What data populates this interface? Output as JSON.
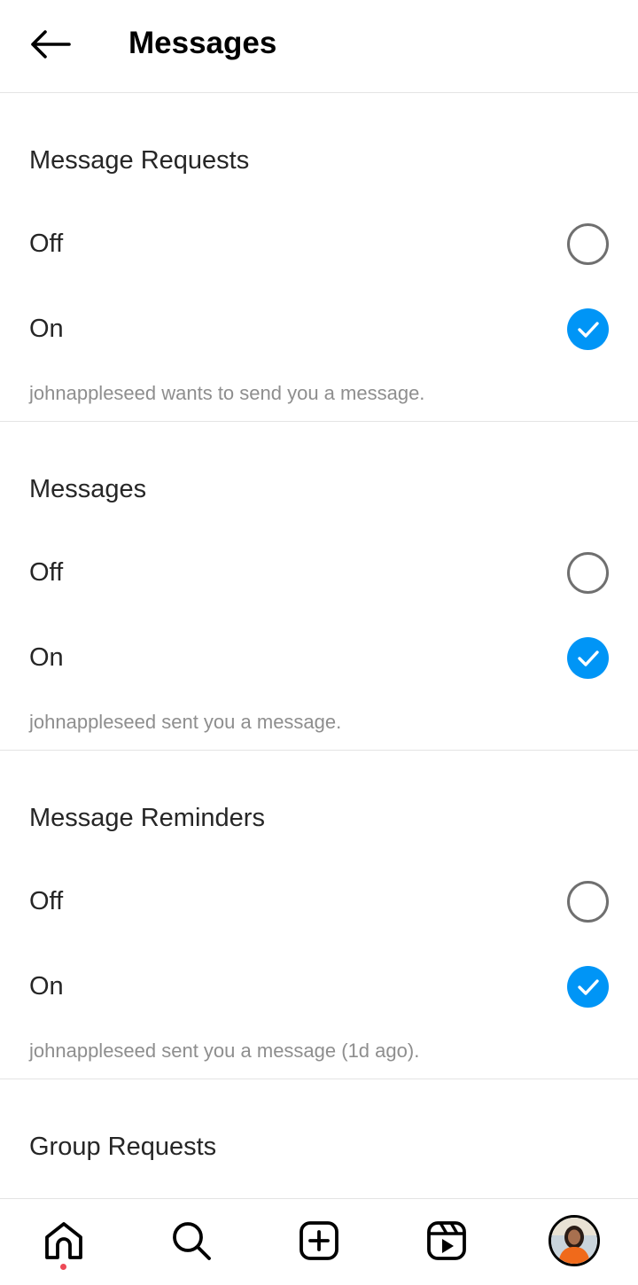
{
  "header": {
    "title": "Messages",
    "back_icon": "arrow-left-icon"
  },
  "sections": [
    {
      "title": "Message Requests",
      "options": [
        {
          "label": "Off",
          "selected": false
        },
        {
          "label": "On",
          "selected": true
        }
      ],
      "description": "johnappleseed wants to send you a message."
    },
    {
      "title": "Messages",
      "options": [
        {
          "label": "Off",
          "selected": false
        },
        {
          "label": "On",
          "selected": true
        }
      ],
      "description": "johnappleseed sent you a message."
    },
    {
      "title": "Message Reminders",
      "options": [
        {
          "label": "Off",
          "selected": false
        },
        {
          "label": "On",
          "selected": true
        }
      ],
      "description": "johnappleseed sent you a message (1d ago)."
    },
    {
      "title": "Group Requests"
    }
  ],
  "bottom_nav": {
    "items": [
      "home-icon",
      "search-icon",
      "create-icon",
      "reels-icon",
      "profile-avatar"
    ],
    "active": "home-icon",
    "notification_dot_color": "#ed4956"
  },
  "colors": {
    "accent": "#0095f6",
    "text_primary": "#262626",
    "text_secondary": "#8e8e8e",
    "divider": "#e4e4e4"
  }
}
